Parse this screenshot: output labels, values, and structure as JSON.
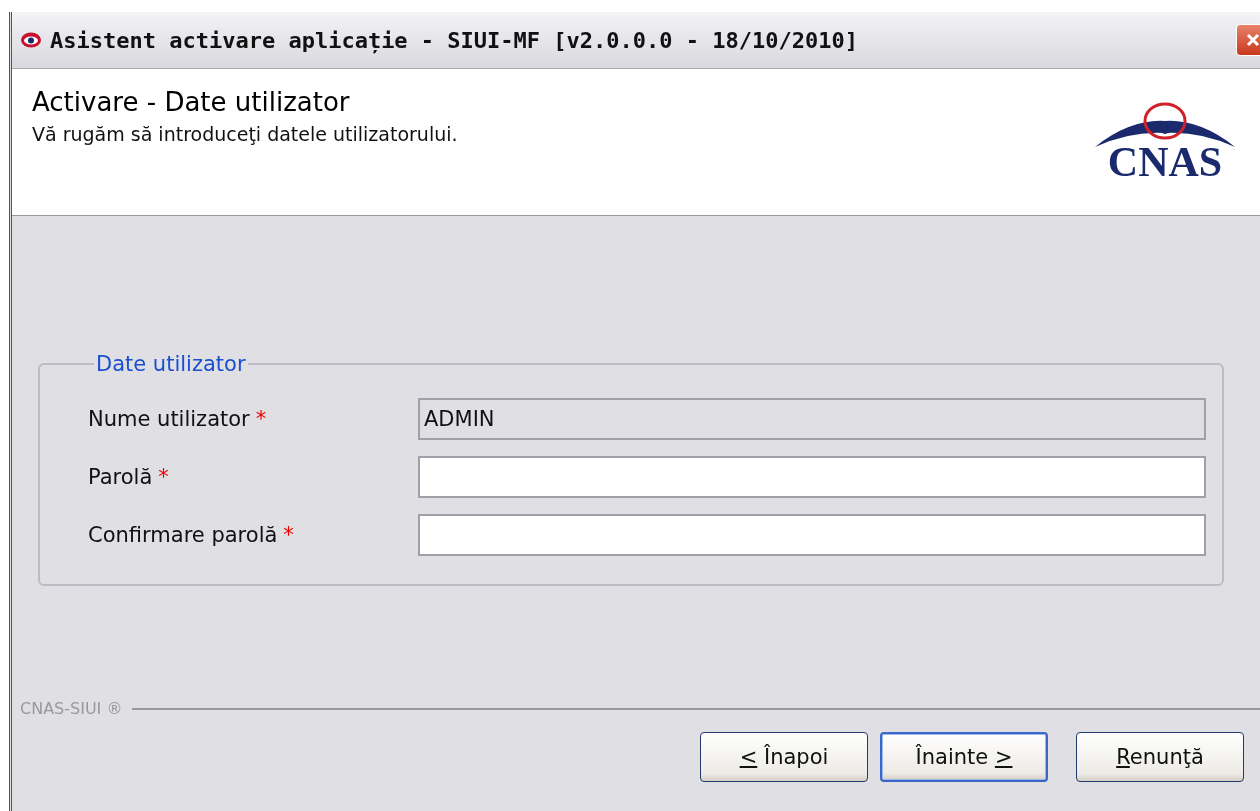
{
  "window": {
    "title": "Asistent activare aplicație - SIUI-MF [v2.0.0.0 - 18/10/2010]"
  },
  "header": {
    "title": "Activare - Date utilizator",
    "subtitle": "Vă rugăm să introduceţi datele utilizatorului.",
    "logo_text": "CNAS"
  },
  "group": {
    "legend": "Date utilizator",
    "fields": [
      {
        "label": "Nume utilizator",
        "required_mark": "*",
        "value": "ADMIN",
        "disabled": true
      },
      {
        "label": "Parolă",
        "required_mark": "*",
        "disabled": false
      },
      {
        "label": "Confirmare parolă",
        "required_mark": "*",
        "disabled": false
      }
    ]
  },
  "footer": {
    "brand": "CNAS-SIUI ®"
  },
  "buttons": [
    {
      "key": "<",
      "after": " Înapoi",
      "default": false
    },
    {
      "before": "Înainte ",
      "key": ">",
      "default": true
    },
    {
      "key": "R",
      "after": "enunţă",
      "default": false
    }
  ]
}
